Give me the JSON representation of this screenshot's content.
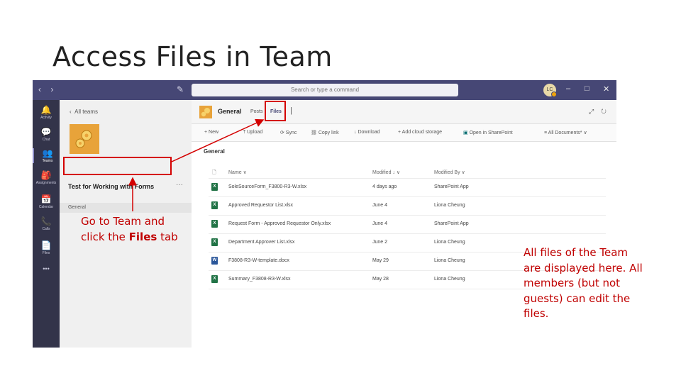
{
  "slide": {
    "title": "Access Files in Team",
    "callout_left_a": "Go to Team and click the ",
    "callout_left_bold": "Files",
    "callout_left_b": " tab",
    "callout_right": "All files of the Team are displayed here. All members (but not guests) can edit the files.",
    "callout_color": "#c00000"
  },
  "titlebar": {
    "back": "‹",
    "forward": "›",
    "compose": "✎",
    "search_placeholder": "Search or type a command",
    "avatar_initials": "LC",
    "minimize": "–",
    "maximize": "□",
    "close": "✕",
    "color": "#464775"
  },
  "rail": {
    "items": [
      {
        "label": "Activity",
        "icon": "bell-icon",
        "glyph": "🔔"
      },
      {
        "label": "Chat",
        "icon": "chat-icon",
        "glyph": "💬"
      },
      {
        "label": "Teams",
        "icon": "teams-icon",
        "glyph": "👥"
      },
      {
        "label": "Assignments",
        "icon": "assignments-icon",
        "glyph": "🎒"
      },
      {
        "label": "Calendar",
        "icon": "calendar-icon",
        "glyph": "📅"
      },
      {
        "label": "Calls",
        "icon": "phone-icon",
        "glyph": "📞"
      },
      {
        "label": "Files",
        "icon": "files-icon",
        "glyph": "📄"
      }
    ],
    "more": "•••"
  },
  "team_pane": {
    "all_teams": "All teams",
    "team_name": "Test for Working with Forms",
    "more": "···",
    "channel": "General"
  },
  "channel": {
    "name": "General",
    "tab_posts": "Posts",
    "tab_files": "Files",
    "add_tab": "|",
    "expand_icon": "⤢",
    "refresh_icon": "↻"
  },
  "toolbar": {
    "new": "+ New",
    "upload": "⤒ Upload",
    "sync": "⟳ Sync",
    "copy_link": "⛓ Copy link",
    "download": "↓ Download",
    "add_cloud": "+ Add cloud storage",
    "open_sharepoint": "Open in SharePoint",
    "all_documents": "All Documents*"
  },
  "breadcrumb": "General",
  "files": {
    "headers": {
      "name": "Name ∨",
      "modified": "Modified ↓ ∨",
      "modified_by": "Modified By ∨"
    },
    "rows": [
      {
        "name": "SoleSourceForm_F3800-R3-W.xlsx",
        "modified": "4 days ago",
        "modified_by": "SharePoint App",
        "type": "xlsx",
        "color": "#217346"
      },
      {
        "name": "Approved Requestor List.xlsx",
        "modified": "June 4",
        "modified_by": "Liona Cheung",
        "type": "xlsx",
        "color": "#217346"
      },
      {
        "name": "Request Form - Approved Requestor Only.xlsx",
        "modified": "June 4",
        "modified_by": "SharePoint App",
        "type": "xlsx",
        "color": "#217346"
      },
      {
        "name": "Department Approver List.xlsx",
        "modified": "June 2",
        "modified_by": "Liona Cheung",
        "type": "xlsx",
        "color": "#217346"
      },
      {
        "name": "F3808-R3-W-template.docx",
        "modified": "May 29",
        "modified_by": "Liona Cheung",
        "type": "docx",
        "color": "#2b579a"
      },
      {
        "name": "Summary_F3808-R3-W.xlsx",
        "modified": "May 28",
        "modified_by": "Liona Cheung",
        "type": "xlsx",
        "color": "#217346"
      }
    ]
  }
}
